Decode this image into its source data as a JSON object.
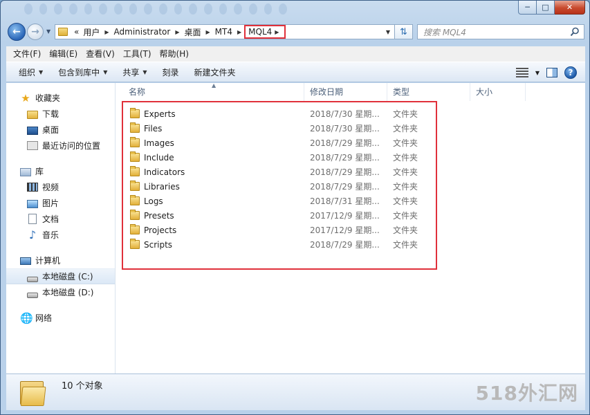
{
  "search": {
    "placeholder": "搜索 MQL4"
  },
  "breadcrumb": {
    "overflow": "«",
    "items": [
      "用户",
      "Administrator",
      "桌面",
      "MT4",
      "MQL4"
    ]
  },
  "menu": [
    "文件(F)",
    "编辑(E)",
    "查看(V)",
    "工具(T)",
    "帮助(H)"
  ],
  "toolbar": {
    "organize": "组织",
    "include_library": "包含到库中",
    "share": "共享",
    "burn": "刻录",
    "new_folder": "新建文件夹"
  },
  "nav": {
    "favorites": "收藏夹",
    "downloads": "下载",
    "desktop": "桌面",
    "recent": "最近访问的位置",
    "libraries": "库",
    "videos": "视频",
    "pictures": "图片",
    "documents": "文档",
    "music": "音乐",
    "computer": "计算机",
    "drive_c": "本地磁盘 (C:)",
    "drive_d": "本地磁盘 (D:)",
    "network": "网络"
  },
  "columns": {
    "name": "名称",
    "date": "修改日期",
    "type": "类型",
    "size": "大小"
  },
  "files": [
    {
      "name": "Experts",
      "date": "2018/7/30 星期...",
      "type": "文件夹"
    },
    {
      "name": "Files",
      "date": "2018/7/30 星期...",
      "type": "文件夹"
    },
    {
      "name": "Images",
      "date": "2018/7/29 星期...",
      "type": "文件夹"
    },
    {
      "name": "Include",
      "date": "2018/7/29 星期...",
      "type": "文件夹"
    },
    {
      "name": "Indicators",
      "date": "2018/7/29 星期...",
      "type": "文件夹"
    },
    {
      "name": "Libraries",
      "date": "2018/7/29 星期...",
      "type": "文件夹"
    },
    {
      "name": "Logs",
      "date": "2018/7/31 星期...",
      "type": "文件夹"
    },
    {
      "name": "Presets",
      "date": "2017/12/9 星期...",
      "type": "文件夹"
    },
    {
      "name": "Projects",
      "date": "2017/12/9 星期...",
      "type": "文件夹"
    },
    {
      "name": "Scripts",
      "date": "2018/7/29 星期...",
      "type": "文件夹"
    }
  ],
  "status": {
    "count": "10 个对象"
  },
  "watermark": "518外汇网",
  "colors": {
    "highlight": "#e0303a",
    "close_button": "#c84a2e"
  }
}
